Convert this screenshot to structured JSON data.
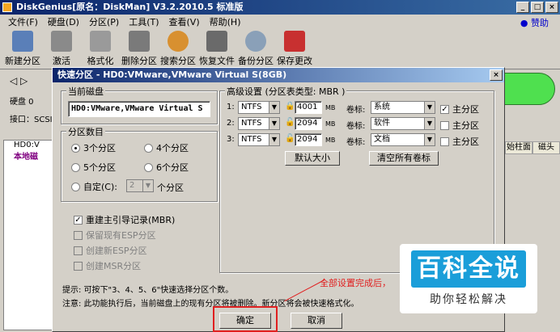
{
  "app": {
    "title": "DiskGenius[原名：DiskMan] V3.2.2010.5 标准版",
    "help_link": "赞助"
  },
  "menu": [
    "文件(F)",
    "硬盘(D)",
    "分区(P)",
    "工具(T)",
    "查看(V)",
    "帮助(H)"
  ],
  "toolbar": [
    {
      "label": "新建分区",
      "icon": "new-partition-icon",
      "color": "#5a7fb8"
    },
    {
      "label": "激活",
      "icon": "activate-icon",
      "color": "#8a8a8a"
    },
    {
      "label": "格式化",
      "icon": "format-icon",
      "color": "#9a9a9a"
    },
    {
      "label": "删除分区",
      "icon": "delete-partition-icon",
      "color": "#7a7a7a"
    },
    {
      "label": "搜索分区",
      "icon": "search-partition-icon",
      "color": "#d89030"
    },
    {
      "label": "恢复文件",
      "icon": "recover-file-icon",
      "color": "#6a6a6a"
    },
    {
      "label": "备份分区",
      "icon": "backup-partition-icon",
      "color": "#8aa0b8"
    },
    {
      "label": "保存更改",
      "icon": "save-changes-icon",
      "color": "#c83030"
    }
  ],
  "left_panel": {
    "disk_label": "硬盘 0",
    "interface_label": "接口：SCSI",
    "tree": [
      "HD0:V",
      "本地磁"
    ]
  },
  "grid_headers": [
    "始柱面",
    "磁头"
  ],
  "dialog": {
    "title": "快速分区 - HD0:VMware,VMware Virtual S(8GB)",
    "current_disk": {
      "label": "当前磁盘",
      "value": "HD0:VMware,VMware Virtual S"
    },
    "partition_count": {
      "label": "分区数目",
      "options": [
        "3个分区",
        "4个分区",
        "5个分区",
        "6个分区"
      ],
      "selected": "3个分区",
      "custom_label": "自定(C):",
      "custom_value": "2",
      "custom_suffix": "个分区"
    },
    "checkboxes": [
      {
        "label": "重建主引导记录(MBR)",
        "checked": true,
        "enabled": true
      },
      {
        "label": "保留现有ESP分区",
        "checked": false,
        "enabled": false
      },
      {
        "label": "创建新ESP分区",
        "checked": false,
        "enabled": false
      },
      {
        "label": "创建MSR分区",
        "checked": false,
        "enabled": false
      }
    ],
    "advanced": {
      "label": "高级设置 (分区表类型: MBR )",
      "rows": [
        {
          "index": "1:",
          "fs": "NTFS",
          "size": "4001",
          "unit": "MB",
          "vol_label_text": "卷标:",
          "vol_label": "系统",
          "primary_label": "主分区",
          "primary": true
        },
        {
          "index": "2:",
          "fs": "NTFS",
          "size": "2094",
          "unit": "MB",
          "vol_label_text": "卷标:",
          "vol_label": "软件",
          "primary_label": "主分区",
          "primary": false
        },
        {
          "index": "3:",
          "fs": "NTFS",
          "size": "2094",
          "unit": "MB",
          "vol_label_text": "卷标:",
          "vol_label": "文档",
          "primary_label": "主分区",
          "primary": false
        }
      ],
      "default_size_btn": "默认大小",
      "clear_labels_btn": "清空所有卷标"
    },
    "tip": "提示: 可按下\"3、4、5、6\"快速选择分区个数。",
    "warning": "注意: 此功能执行后，当前磁盘上的现有分区将被删除。新分区将会被快速格式化。",
    "ok_btn": "确定",
    "cancel_btn": "取消"
  },
  "annotation": "全部设置完成后，",
  "watermark": {
    "logo": "百科全说",
    "sub": "助你轻松解决"
  }
}
